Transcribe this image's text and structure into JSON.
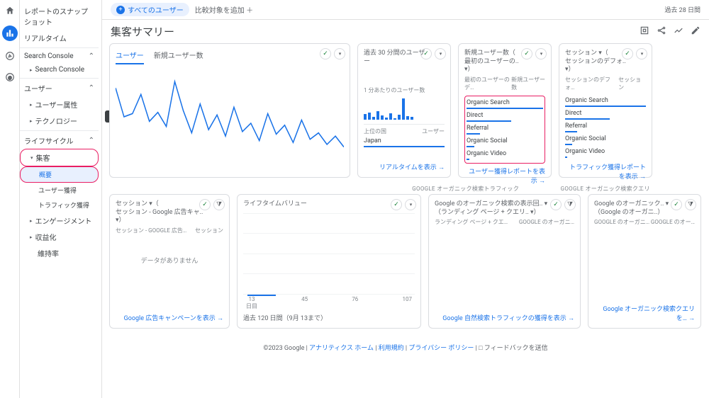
{
  "date_range": "過去 28 日間",
  "segment_chip": "すべてのユーザー",
  "segment_add": "比較対象を追加 ＋",
  "page_title": "集客サマリー",
  "tooltip": "集客",
  "sidebar": {
    "items": [
      "レポートのスナップショット",
      "リアルタイム",
      "Search Console",
      "Search Console",
      "ユーザー",
      "ユーザー属性",
      "テクノロジー",
      "ライフサイクル",
      "集客",
      "概要",
      "ユーザー獲得",
      "トラフィック獲得",
      "エンゲージメント",
      "収益化",
      "維持率"
    ]
  },
  "card1": {
    "tabs": [
      "ユーザー",
      "新規ユーザー数"
    ]
  },
  "card2": {
    "title": "過去 30 分間のユーザー",
    "sub1": "1 分あたりのユーザー数",
    "row_l": "上位の国",
    "row_r": "ユーザー",
    "country": "Japan",
    "link": "リアルタイムを表示"
  },
  "card3": {
    "title1": "新規ユーザー数（",
    "title2": "最初のユーザーの..",
    "sub_l": "最初のユーザーのデ…",
    "sub_r": "新規ユーザー数",
    "sources": [
      "Organic Search",
      "Direct",
      "Referral",
      "Organic Social",
      "Organic Video"
    ],
    "link": "ユーザー獲得レポートを表示"
  },
  "card4": {
    "title1": "セッション ▾（",
    "title2": "セッションのデフォ.. ▾）",
    "sub_l": "セッションのデフォ…",
    "sub_r": "セッション",
    "sources": [
      "Organic Search",
      "Direct",
      "Referral",
      "Organic Social",
      "Organic Video"
    ],
    "link": "トラフィック獲得レポートを表示"
  },
  "card5": {
    "title1": "セッション ▾（",
    "title2": "セッション - Google 広告キャ.. ▾）",
    "sub_l": "セッション - GOOGLE 広告…",
    "sub_r": "セッション",
    "nodata": "データがありません",
    "link": "Google 広告キャンペーンを表示"
  },
  "card6": {
    "title": "ライフタイムバリュー",
    "axis": [
      "13\n日目",
      "45",
      "76",
      "107"
    ],
    "footer": "過去 120 日間（9月 13まで）"
  },
  "sec_label_a": "GOOGLE オーガニック検索トラフィック",
  "sec_label_b": "GOOGLE オーガニック検索クエリ",
  "card7": {
    "title1": "Google のオーガニック検索の表示回.. ▾",
    "title2": "（ランディング ページ + クエリ.. ▾）",
    "sub_l": "ランディング ページ + クエ…",
    "sub_r": "GOOGLE のオーガニ…",
    "link": "Google 自然検索トラフィックの獲得を表示"
  },
  "card8": {
    "title1": "Google のオーガニック.. ▾",
    "title2": "（Google のオーガニ..）",
    "sub_l": "GOOGLE のオーガニ…",
    "sub_r": "GOOGLE のオー…",
    "link": "Google オーガニック検索クエリを…"
  },
  "chart_data": {
    "type": "line",
    "series_name": "ユーザー",
    "values": [
      130,
      85,
      90,
      120,
      78,
      92,
      70,
      140,
      95,
      60,
      105,
      65,
      88,
      55,
      100,
      62,
      75,
      48,
      90,
      58,
      72,
      45,
      80,
      50,
      60,
      42,
      55,
      38
    ],
    "ylim": [
      0,
      160
    ]
  },
  "bar30min": {
    "values": [
      8,
      10,
      4,
      12,
      6,
      3,
      9,
      2,
      7,
      30,
      5,
      4
    ]
  },
  "source_bars": {
    "new_users": [
      100,
      58,
      18,
      10,
      4
    ],
    "sessions": [
      100,
      55,
      15,
      9,
      3
    ]
  },
  "footer": {
    "copyright": "©2023 Google |",
    "links": [
      "アナリティクス ホーム",
      "利用規約",
      "プライバシー ポリシー"
    ],
    "feedback": "フィードバックを送信"
  }
}
